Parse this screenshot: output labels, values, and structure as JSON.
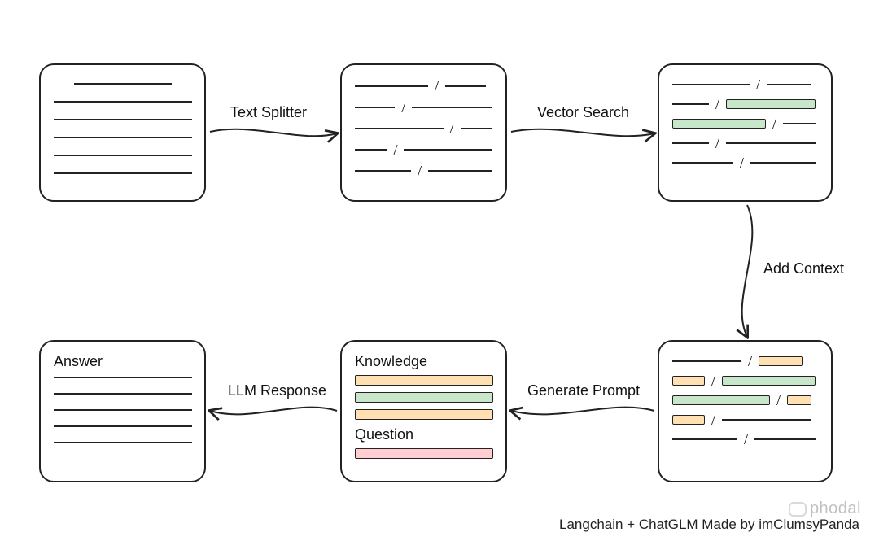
{
  "labels": {
    "text_splitter": "Text Splitter",
    "vector_search": "Vector Search",
    "add_context": "Add Context",
    "generate_prompt": "Generate Prompt",
    "llm_response": "LLM Response"
  },
  "nodes": {
    "answer_title": "Answer",
    "knowledge_title": "Knowledge",
    "question_title": "Question"
  },
  "footer": "Langchain + ChatGLM Made by imClumsyPanda",
  "watermark": "phodal",
  "colors": {
    "green": "#c8e6c9",
    "orange": "#ffe0b2",
    "red": "#ffcdd2",
    "stroke": "#222222"
  },
  "diagram": {
    "type": "flow",
    "description": "RAG pipeline. A raw document is split into chunks (Text Splitter). Chunks are embedded and the most relevant ones are retrieved (Vector Search, highlighted green). Surrounding chunks are included as context (Add Context, highlighted orange around the green hits). Retrieved context plus the user question are composed into a prompt (Generate Prompt). The prompt is sent to the LLM which returns the final Answer (LLM Response).",
    "steps": [
      {
        "id": "raw_document",
        "kind": "document"
      },
      {
        "id": "text_splitter",
        "kind": "arrow",
        "label_key": "labels.text_splitter"
      },
      {
        "id": "chunks",
        "kind": "chunks"
      },
      {
        "id": "vector_search",
        "kind": "arrow",
        "label_key": "labels.vector_search"
      },
      {
        "id": "retrieved",
        "kind": "chunks_highlight_green"
      },
      {
        "id": "add_context",
        "kind": "arrow",
        "label_key": "labels.add_context"
      },
      {
        "id": "context",
        "kind": "chunks_highlight_green_orange"
      },
      {
        "id": "generate_prompt",
        "kind": "arrow",
        "label_key": "labels.generate_prompt"
      },
      {
        "id": "prompt",
        "kind": "prompt",
        "sections": [
          "Knowledge",
          "Question"
        ]
      },
      {
        "id": "llm_response",
        "kind": "arrow",
        "label_key": "labels.llm_response"
      },
      {
        "id": "answer",
        "kind": "answer"
      }
    ]
  }
}
